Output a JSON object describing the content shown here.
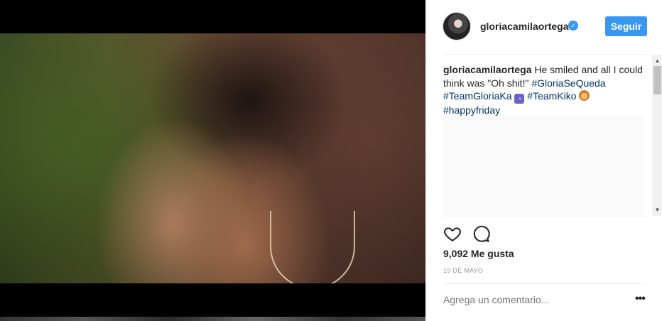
{
  "post": {
    "username": "gloriacamilaortega",
    "verified_badge": "✓",
    "follow_label": "Seguir",
    "caption": {
      "user": "gloriacamilaortega",
      "text": "He smiled and all I could think was \"Oh shit!\"",
      "tag1": "#GloriaSeQueda",
      "tag2": "#TeamGloriaKa",
      "tag3": "#TeamKiko",
      "tag4": "#happyfriday"
    },
    "likes": "9,092 Me gusta",
    "date": "19 DE MAYO",
    "comment_placeholder": "Agrega un comentario...",
    "more_label": "•••"
  },
  "icons": {
    "like": "heart-icon",
    "comment": "comment-icon",
    "more": "more-options-icon",
    "verified": "verified-badge-icon"
  },
  "colors": {
    "accent": "#3897f0",
    "hashtag": "#003569",
    "muted": "#999999",
    "text": "#262626"
  }
}
